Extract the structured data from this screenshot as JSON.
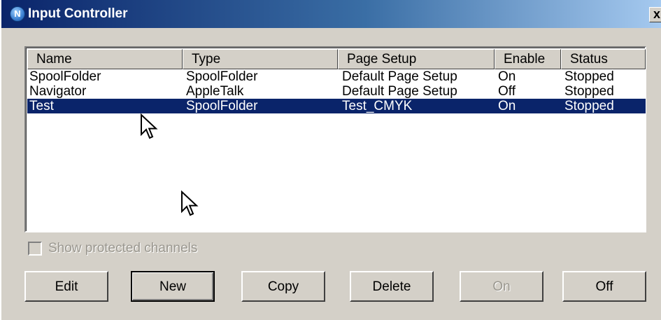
{
  "window": {
    "title": "Input Controller",
    "icon_letter": "N",
    "close_glyph": "x"
  },
  "list": {
    "columns": [
      "Name",
      "Type",
      "Page Setup",
      "Enable",
      "Status"
    ],
    "rows": [
      [
        "SpoolFolder",
        "SpoolFolder",
        "Default Page Setup",
        "On",
        "Stopped"
      ],
      [
        "Navigator",
        "AppleTalk",
        "Default Page Setup",
        "Off",
        "Stopped"
      ],
      [
        "Test",
        "SpoolFolder",
        "Test_CMYK",
        "On",
        "Stopped"
      ]
    ],
    "selected_row": 2
  },
  "options": {
    "show_protected_label": "Show protected channels",
    "show_protected_checked": false
  },
  "buttons": {
    "edit": "Edit",
    "new": "New",
    "copy": "Copy",
    "delete": "Delete",
    "on": "On",
    "off": "Off"
  },
  "colors": {
    "selection": "#0a246a",
    "face": "#d4d0c8",
    "title_start": "#0a246a",
    "title_end": "#a6caf0"
  }
}
